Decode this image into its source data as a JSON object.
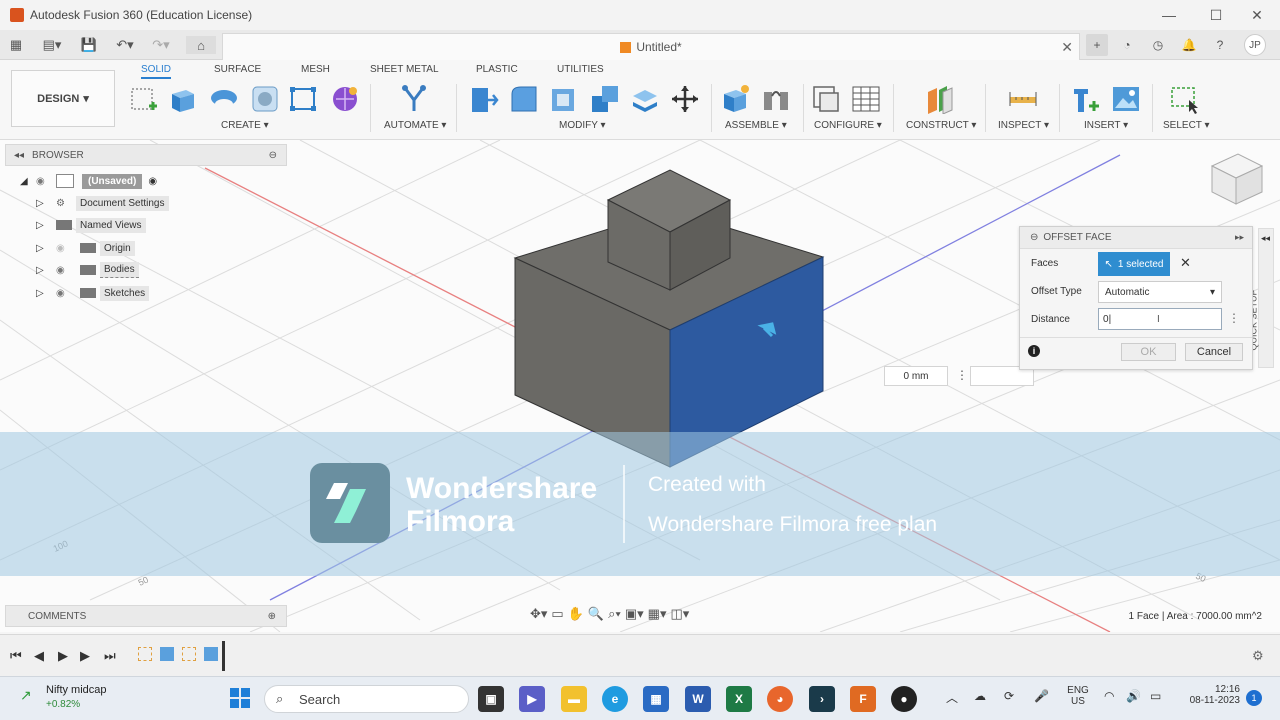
{
  "window": {
    "title": "Autodesk Fusion 360 (Education License)"
  },
  "document": {
    "tab_title": "Untitled*",
    "user_initials": "JP"
  },
  "workspace": {
    "mode": "DESIGN",
    "tabs": [
      "SOLID",
      "SURFACE",
      "MESH",
      "SHEET METAL",
      "PLASTIC",
      "UTILITIES"
    ],
    "active_tab": "SOLID"
  },
  "toolbar": {
    "create": "CREATE ▾",
    "automate": "AUTOMATE ▾",
    "modify": "MODIFY ▾",
    "assemble": "ASSEMBLE ▾",
    "configure": "CONFIGURE ▾",
    "construct": "CONSTRUCT ▾",
    "inspect": "INSPECT ▾",
    "insert": "INSERT ▾",
    "select": "SELECT ▾"
  },
  "browser": {
    "title": "BROWSER",
    "items": [
      "(Unsaved)",
      "Document Settings",
      "Named Views",
      "Origin",
      "Bodies",
      "Sketches"
    ]
  },
  "offset_face": {
    "title": "OFFSET FACE",
    "faces_label": "Faces",
    "faces_value": "1 selected",
    "offset_type_label": "Offset Type",
    "offset_type_value": "Automatic",
    "distance_label": "Distance",
    "distance_value": "0",
    "ok": "OK",
    "cancel": "Cancel"
  },
  "quick_setup": "QUICK SETUP",
  "measure_value": "0 mm",
  "watermark": {
    "brand_line1": "Wondershare",
    "brand_line2": "Filmora",
    "line1": "Created with",
    "line2": "Wondershare Filmora free plan"
  },
  "comments": {
    "title": "COMMENTS"
  },
  "status_text": "1 Face | Area : 7000.00 mm^2",
  "axis_labels": [
    "100",
    "50",
    "50"
  ],
  "taskbar": {
    "widget_title": "Nifty midcap",
    "widget_value": "+0.82%",
    "search": "Search",
    "lang1": "ENG",
    "lang2": "US",
    "time": "12:16",
    "date": "08-11-2023",
    "notification_count": "1"
  },
  "colors": {
    "accent": "#2a7fd0",
    "selected_face": "#2d5aa0",
    "body": "#6e6e6e"
  }
}
